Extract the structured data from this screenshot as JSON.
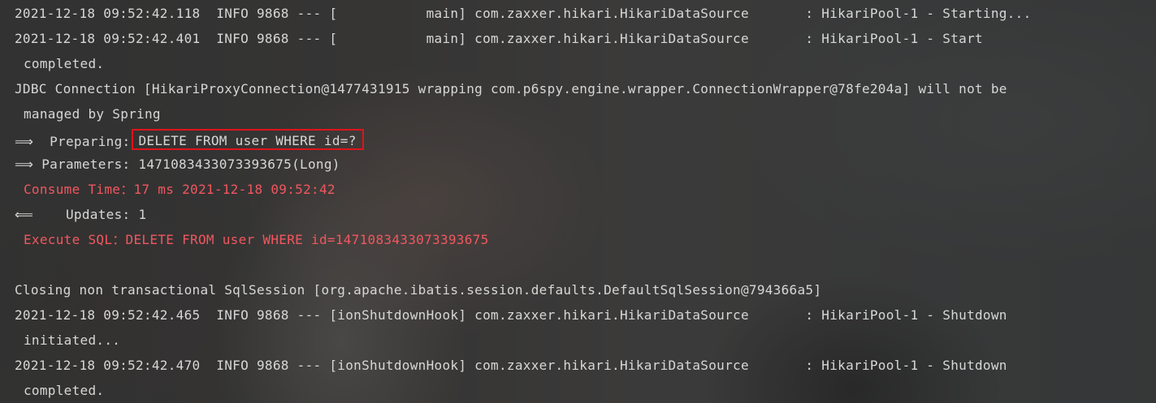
{
  "console": {
    "lines": [
      "2021-12-18 09:52:42.118  INFO 9868 --- [           main] com.zaxxer.hikari.HikariDataSource       : HikariPool-1 - Starting...",
      "2021-12-18 09:52:42.401  INFO 9868 --- [           main] com.zaxxer.hikari.HikariDataSource       : HikariPool-1 - Start",
      "completed.",
      "JDBC Connection [HikariProxyConnection@1477431915 wrapping com.p6spy.engine.wrapper.ConnectionWrapper@78fe204a] will not be",
      "managed by Spring",
      "Preparing:",
      "DELETE FROM user WHERE id=?",
      "Parameters: 1471083433073393675(Long)",
      "Consume Time：17 ms 2021-12-18 09:52:42",
      "Updates: 1",
      "Execute SQL：DELETE FROM user WHERE id=1471083433073393675",
      "Closing non transactional SqlSession [org.apache.ibatis.session.defaults.DefaultSqlSession@794366a5]",
      "2021-12-18 09:52:42.465  INFO 9868 --- [ionShutdownHook] com.zaxxer.hikari.HikariDataSource       : HikariPool-1 - Shutdown",
      "initiated...",
      "2021-12-18 09:52:42.470  INFO 9868 --- [ionShutdownHook] com.zaxxer.hikari.HikariDataSource       : HikariPool-1 - Shutdown",
      "completed."
    ],
    "arrow_out": "==>",
    "arrow_in": "<==",
    "colors": {
      "text": "#d7d7d7",
      "error": "#f0575f",
      "highlight_border": "#e0131b"
    }
  }
}
